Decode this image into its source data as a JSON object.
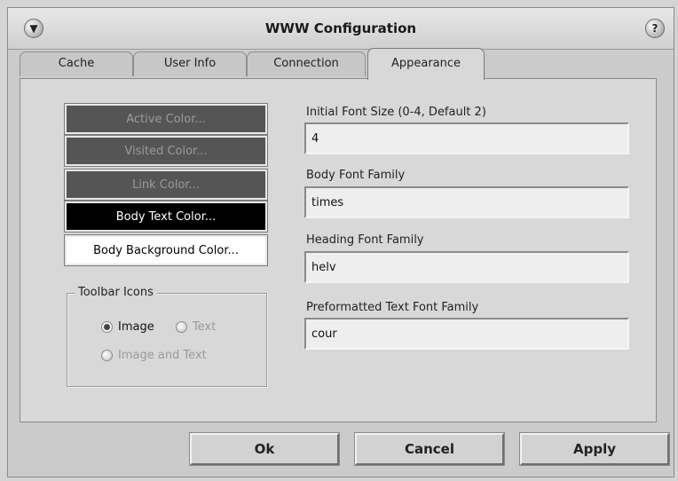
{
  "window": {
    "title": "WWW Configuration",
    "menu_glyph": "▼",
    "help_glyph": "?"
  },
  "tabs": [
    {
      "label": "Cache",
      "active": false
    },
    {
      "label": "User Info",
      "active": false
    },
    {
      "label": "Connection",
      "active": false
    },
    {
      "label": "Appearance",
      "active": true
    }
  ],
  "color_buttons": {
    "active": "Active Color...",
    "visited": "Visited Color...",
    "link": "Link Color...",
    "body_text": "Body Text Color...",
    "body_background": "Body Background Color..."
  },
  "toolbar_icons": {
    "title": "Toolbar Icons",
    "options": [
      {
        "label": "Image",
        "selected": true,
        "enabled": true
      },
      {
        "label": "Text",
        "selected": false,
        "enabled": false
      },
      {
        "label": "Image and Text",
        "selected": false,
        "enabled": false
      }
    ]
  },
  "fields": {
    "initial_font_size": {
      "label": "Initial Font Size (0-4, Default 2)",
      "value": "4"
    },
    "body_font_family": {
      "label": "Body Font Family",
      "value": "times"
    },
    "heading_font_family": {
      "label": "Heading Font Family",
      "value": "helv"
    },
    "preformatted_font_family": {
      "label": "Preformatted Text Font Family",
      "value": "cour"
    }
  },
  "buttons": {
    "ok": "Ok",
    "cancel": "Cancel",
    "apply": "Apply"
  },
  "colors": {
    "window_bg": "#cbcbcb",
    "panel_bg": "#d8d8d8",
    "color_button_gray": "#555555",
    "color_button_black": "#000000",
    "color_button_white": "#ffffff"
  }
}
